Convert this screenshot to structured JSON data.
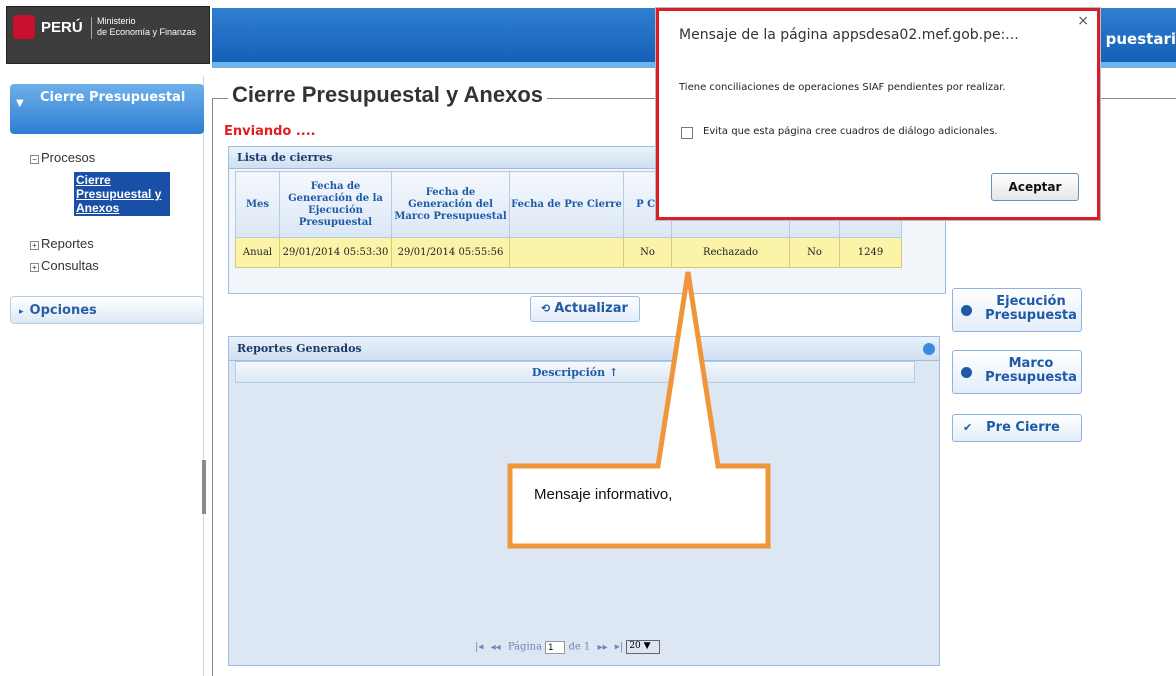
{
  "header": {
    "brand": "PERÚ",
    "ministry_line1": "Ministerio",
    "ministry_line2": "de Economía y Finanzas",
    "app_title": "puestari"
  },
  "sidebar": {
    "section1": "Cierre Presupuestal",
    "tree": {
      "procesos": "Procesos",
      "cierre": "Cierre Presupuestal y Anexos",
      "reportes": "Reportes",
      "consultas": "Consultas"
    },
    "section2": "Opciones"
  },
  "main": {
    "title": "Cierre Presupuestal y Anexos",
    "status": "Enviando ....",
    "grid": {
      "caption": "Lista de cierres",
      "headers": [
        "Mes",
        "Fecha de Generación de la Ejecución Presupuestal",
        "Fecha de Generación del Marco Presupuestal",
        "Fecha de Pre Cierre",
        "P Ci",
        "",
        "",
        ""
      ],
      "row": [
        "Anual",
        "29/01/2014 05:53:30",
        "29/01/2014 05:55:56",
        "",
        "No",
        "Rechazado",
        "No",
        "1249"
      ]
    },
    "refresh_label": "Actualizar",
    "reports": {
      "caption": "Reportes Generados",
      "column": "Descripción ↑",
      "pager": {
        "page_label": "Página",
        "page_value": "1",
        "of_label": "de 1",
        "page_size": "20 ▼"
      }
    },
    "buttons": {
      "ejecucion": "Ejecución Presupuesta",
      "marco": "Marco Presupuesta",
      "precierre": "Pre Cierre"
    }
  },
  "dialog": {
    "title": "Mensaje de la página appsdesa02.mef.gob.pe:...",
    "close": "×",
    "message": "Tiene conciliaciones de operaciones SIAF pendientes por realizar.",
    "checkbox_label": "Evita que esta página cree cuadros de diálogo adicionales.",
    "ok": "Aceptar"
  },
  "callout": {
    "text": "Mensaje informativo,"
  },
  "colors": {
    "header_blue": "#1560b8",
    "dialog_border": "#d81e2a",
    "callout_orange": "#f0963a",
    "row_highlight": "#fbf3a7",
    "status_red": "#e02020"
  }
}
